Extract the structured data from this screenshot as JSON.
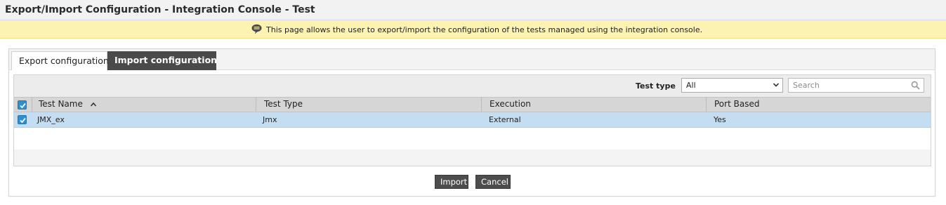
{
  "header": {
    "title": "Export/Import Configuration - Integration Console - Test"
  },
  "info": {
    "message": "This page allows the user to export/import the configuration of the tests managed using the integration console.",
    "icon": "speech-bubble-icon"
  },
  "tabs": [
    {
      "label": "Export configuration",
      "active": false
    },
    {
      "label": "Import configuration",
      "active": true
    }
  ],
  "toolbar": {
    "test_type_label": "Test type",
    "test_type_value": "All",
    "search_placeholder": "Search"
  },
  "table": {
    "columns": [
      "Test Name",
      "Test Type",
      "Execution",
      "Port Based"
    ],
    "sort_column": "Test Name",
    "select_all_checked": true,
    "rows": [
      {
        "checked": true,
        "test_name": "JMX_ex",
        "test_type": "Jmx",
        "execution": "External",
        "port_based": "Yes"
      }
    ]
  },
  "actions": {
    "import_label": "Import",
    "cancel_label": "Cancel"
  },
  "colors": {
    "accent": "#2e8fd0",
    "info_bg": "#fcf3b3",
    "selected_row": "#c4ddf1",
    "button": "#4d4d4d"
  }
}
